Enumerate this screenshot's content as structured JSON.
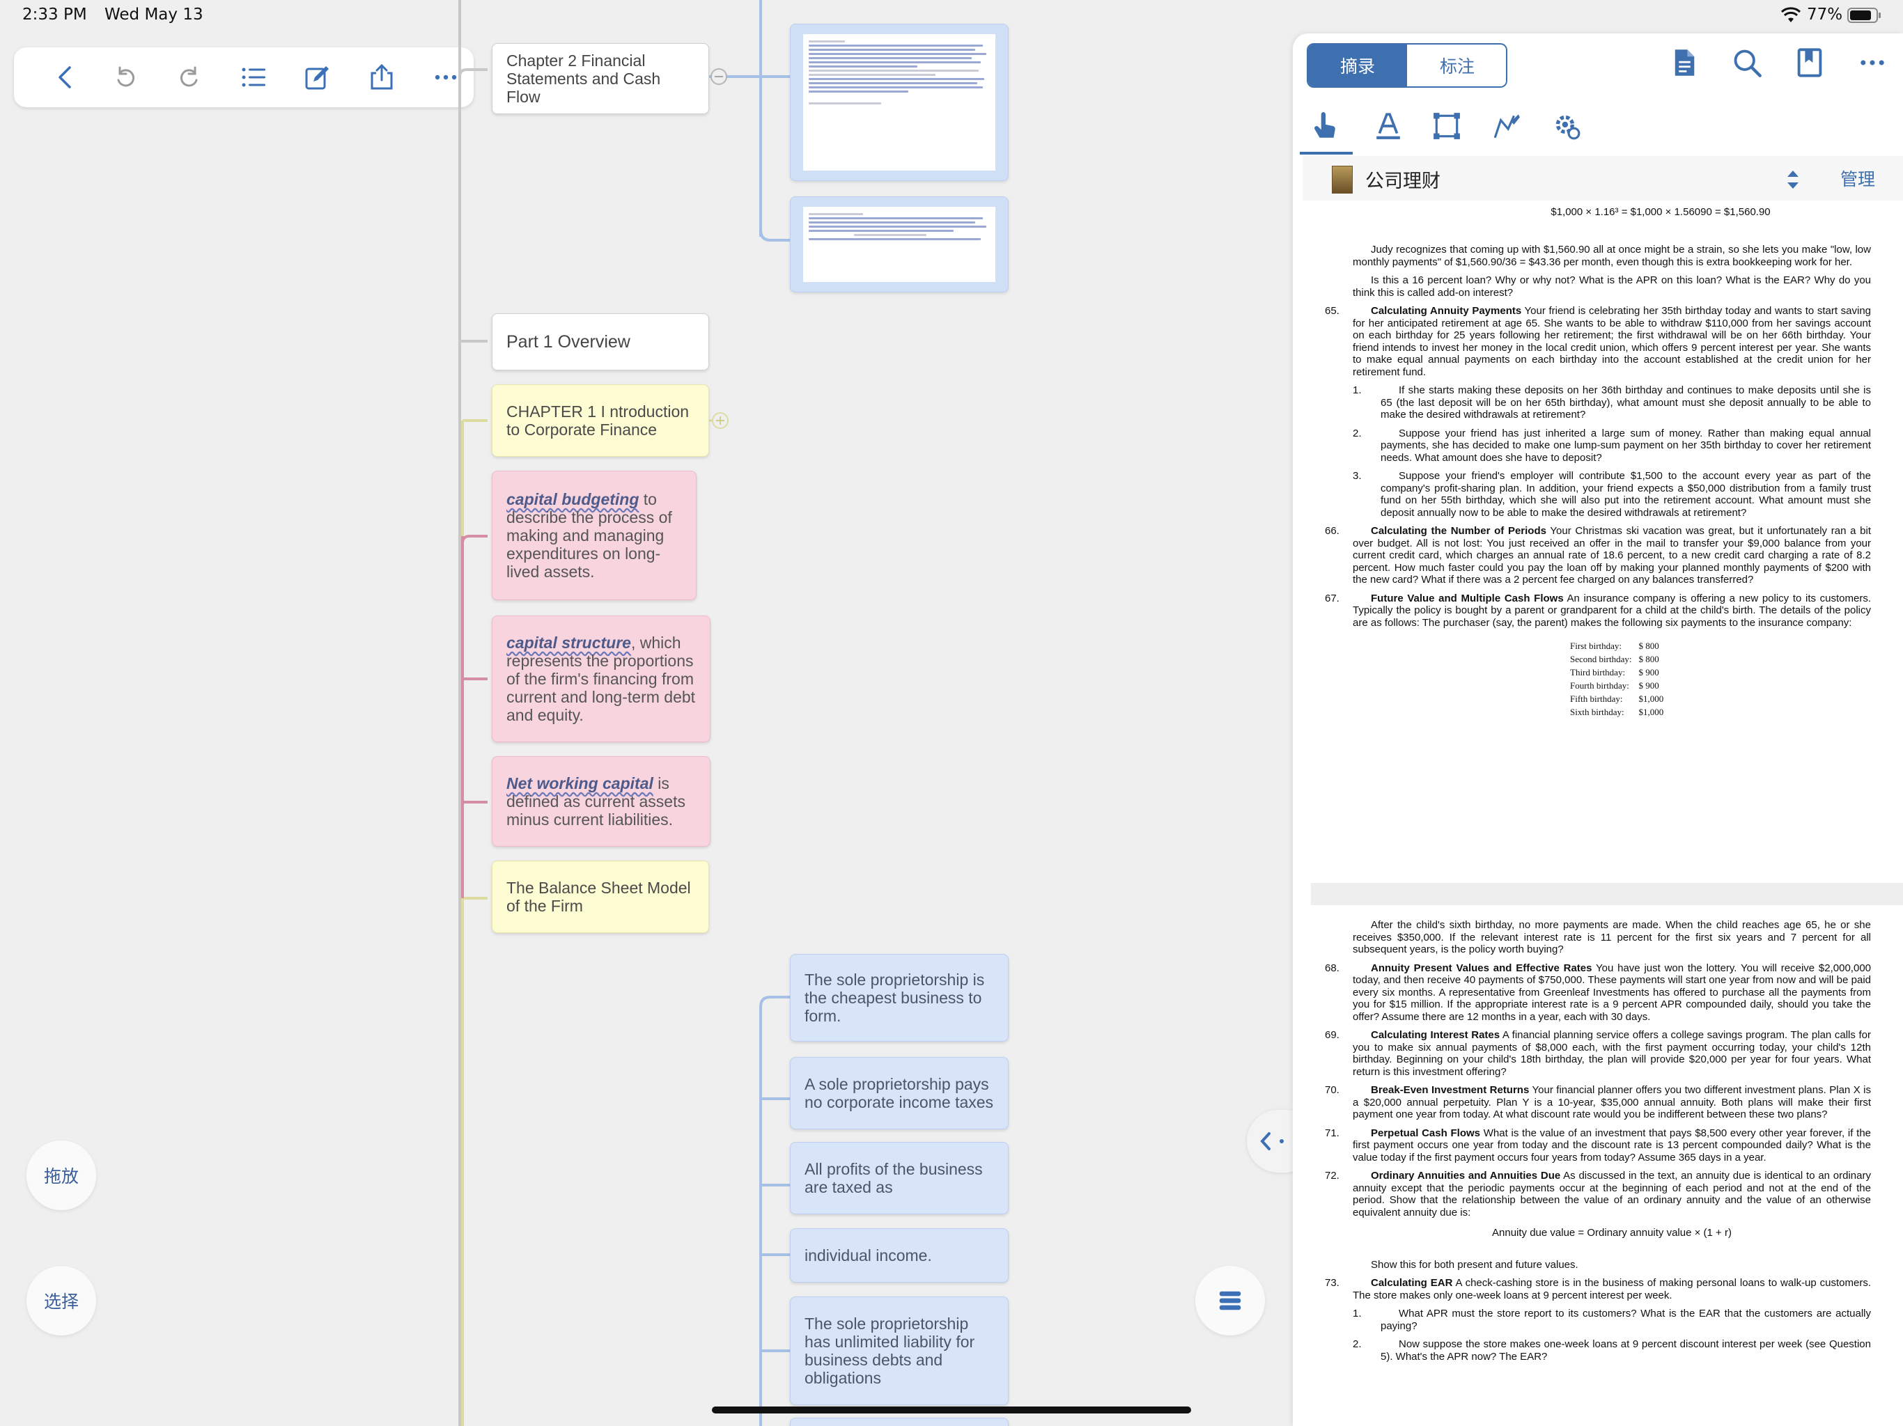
{
  "status_bar": {
    "time": "2:33 PM",
    "date": "Wed May 13",
    "battery": "77%",
    "icons": [
      "wifi-icon",
      "battery-icon"
    ]
  },
  "toolbar": {
    "buttons": [
      "back-chevron-icon",
      "undo-icon",
      "redo-icon",
      "outline-list-icon",
      "edit-icon",
      "share-icon",
      "more-icon"
    ]
  },
  "mindmap": {
    "nodes": {
      "chapter2": "Chapter 2 Financial Statements and Cash Flow",
      "part1": "Part 1 Overview",
      "chapter1": "CHAPTER 1 I ntroduction to Corporate Finance",
      "capital_budgeting_kw": "capital budgeting",
      "capital_budgeting_rest": " to describe the process of making and managing expenditures on long-lived assets.",
      "capital_structure_kw": "capital structure",
      "capital_structure_rest": ", which represents the proportions of the firm's financing from current and long-term debt and equity.",
      "nwc_kw": "Net working capital",
      "nwc_rest": " is defined as current assets minus current liabilities.",
      "balance_sheet": "The Balance Sheet Model of the Firm",
      "sole1": "The sole proprietorship is the cheapest business to form.",
      "sole2": "A sole proprietorship pays no corporate income taxes",
      "sole3": "All profits of the business are taxed as",
      "sole4": "individual income.",
      "sole5": "The sole proprietorship has unlimited liability for business debts and obligations"
    }
  },
  "side_buttons": {
    "drag": "拖放",
    "select": "选择"
  },
  "panel": {
    "tabs": {
      "excerpt": "摘录",
      "annotate": "标注"
    },
    "top_icons": [
      "document-icon",
      "search-icon",
      "bookmark-icon",
      "more-icon"
    ],
    "tool_icons": [
      "hand-pointer-icon",
      "text-highlight-icon",
      "rectangle-select-icon",
      "freehand-icon",
      "settings-gear-icon"
    ],
    "doc_title": "公司理财",
    "manage": "管理",
    "formula": "$1,000 × 1.16³ = $1,000 × 1.56090 = $1,560.90",
    "p1": "Judy recognizes that coming up with $1,560.90 all at once might be a strain, so she lets you make \"low, low monthly payments\" of $1,560.90/36 = $43.36 per month, even though this is extra bookkeeping work for her.",
    "p2": "Is this a 16 percent loan? Why or why not? What is the APR on this loan? What is the EAR? Why do you think this is called add-on interest?",
    "q65": {
      "num": "65.",
      "title": "Calculating Annuity Payments",
      "text": " Your friend is celebrating her 35th birthday today and wants to start saving for her anticipated retirement at age 65. She wants to be able to withdraw $110,000 from her savings account on each birthday for 25 years following her retirement; the first withdrawal will be on her 66th birthday. Your friend intends to invest her money in the local credit union, which offers 9 percent interest per year. She wants to make equal annual payments on each birthday into the account established at the credit union for her retirement fund."
    },
    "q65_1": "If she starts making these deposits on her 36th birthday and continues to make deposits until she is 65 (the last deposit will be on her 65th birthday), what amount must she deposit annually to be able to make the desired withdrawals at retirement?",
    "q65_2": "Suppose your friend has just inherited a large sum of money. Rather than making equal annual payments, she has decided to make one lump-sum payment on her 35th birthday to cover her retirement needs. What amount does she have to deposit?",
    "q65_3": "Suppose your friend's employer will contribute $1,500 to the account every year as part of the company's profit-sharing plan. In addition, your friend expects a $50,000 distribution from a family trust fund on her 55th birthday, which she will also put into the retirement account. What amount must she deposit annually now to be able to make the desired withdrawals at retirement?",
    "q66": {
      "num": "66.",
      "title": "Calculating the Number of Periods",
      "text": " Your Christmas ski vacation was great, but it unfortunately ran a bit over budget. All is not lost: You just received an offer in the mail to transfer your $9,000 balance from your current credit card, which charges an annual rate of 18.6 percent, to a new credit card charging a rate of 8.2 percent. How much faster could you pay the loan off by making your planned monthly payments of $200 with the new card? What if there was a 2 percent fee charged on any balances transferred?"
    },
    "q67": {
      "num": "67.",
      "title": "Future Value and Multiple Cash Flows",
      "text": " An insurance company is offering a new policy to its customers. Typically the policy is bought by a parent or grandparent for a child at the child's birth. The details of the policy are as follows: The purchaser (say, the parent) makes the following six payments to the insurance company:"
    },
    "payments": [
      [
        "First birthday:",
        "$  800"
      ],
      [
        "Second birthday:",
        "$  800"
      ],
      [
        "Third birthday:",
        "$  900"
      ],
      [
        "Fourth birthday:",
        "$  900"
      ],
      [
        "Fifth birthday:",
        "$1,000"
      ],
      [
        "Sixth birthday:",
        "$1,000"
      ]
    ],
    "p3": "After the child's sixth birthday, no more payments are made. When the child reaches age 65, he or she receives $350,000. If the relevant interest rate is 11 percent for the first six years and 7 percent for all subsequent years, is the policy worth buying?",
    "q68": {
      "num": "68.",
      "title": "Annuity Present Values and Effective Rates",
      "text": " You have just won the lottery. You will receive $2,000,000 today, and then receive 40 payments of $750,000. These payments will start one year from now and will be paid every six months. A representative from Greenleaf Investments has offered to purchase all the payments from you for $15 million. If the appropriate interest rate is a 9 percent APR compounded daily, should you take the offer? Assume there are 12 months in a year, each with 30 days."
    },
    "q69": {
      "num": "69.",
      "title": "Calculating Interest Rates",
      "text": " A financial planning service offers a college savings program. The plan calls for you to make six annual payments of $8,000 each, with the first payment occurring today, your child's 12th birthday. Beginning on your child's 18th birthday, the plan will provide $20,000 per year for four years. What return is this investment offering?"
    },
    "q70": {
      "num": "70.",
      "title": "Break-Even Investment Returns",
      "text": " Your financial planner offers you two different investment plans. Plan X is a $20,000 annual perpetuity. Plan Y is a 10-year, $35,000 annual annuity. Both plans will make their first payment one year from today. At what discount rate would you be indifferent between these two plans?"
    },
    "q71": {
      "num": "71.",
      "title": "Perpetual Cash Flows",
      "text": " What is the value of an investment that pays $8,500 every other year forever, if the first payment occurs one year from today and the discount rate is 13 percent compounded daily? What is the value today if the first payment occurs four years from today? Assume 365 days in a year."
    },
    "q72": {
      "num": "72.",
      "title": "Ordinary Annuities and Annuities Due",
      "text": " As discussed in the text, an annuity due is identical to an ordinary annuity except that the periodic payments occur at the beginning of each period and not at the end of the period. Show that the relationship between the value of an ordinary annuity and the value of an otherwise equivalent annuity due is:"
    },
    "formula2": "Annuity due value = Ordinary annuity value × (1 + r)",
    "p4": "Show this for both present and future values.",
    "q73": {
      "num": "73.",
      "title": "Calculating EAR",
      "text": " A check-cashing store is in the business of making personal loans to walk-up customers. The store makes only one-week loans at 9 percent interest per week."
    },
    "q73_1": "What APR must the store report to its customers? What is the EAR that the customers are actually paying?",
    "q73_2": "Now suppose the store makes one-week loans at 9 percent discount interest per week (see Question 5). What's the APR now? The EAR?"
  }
}
